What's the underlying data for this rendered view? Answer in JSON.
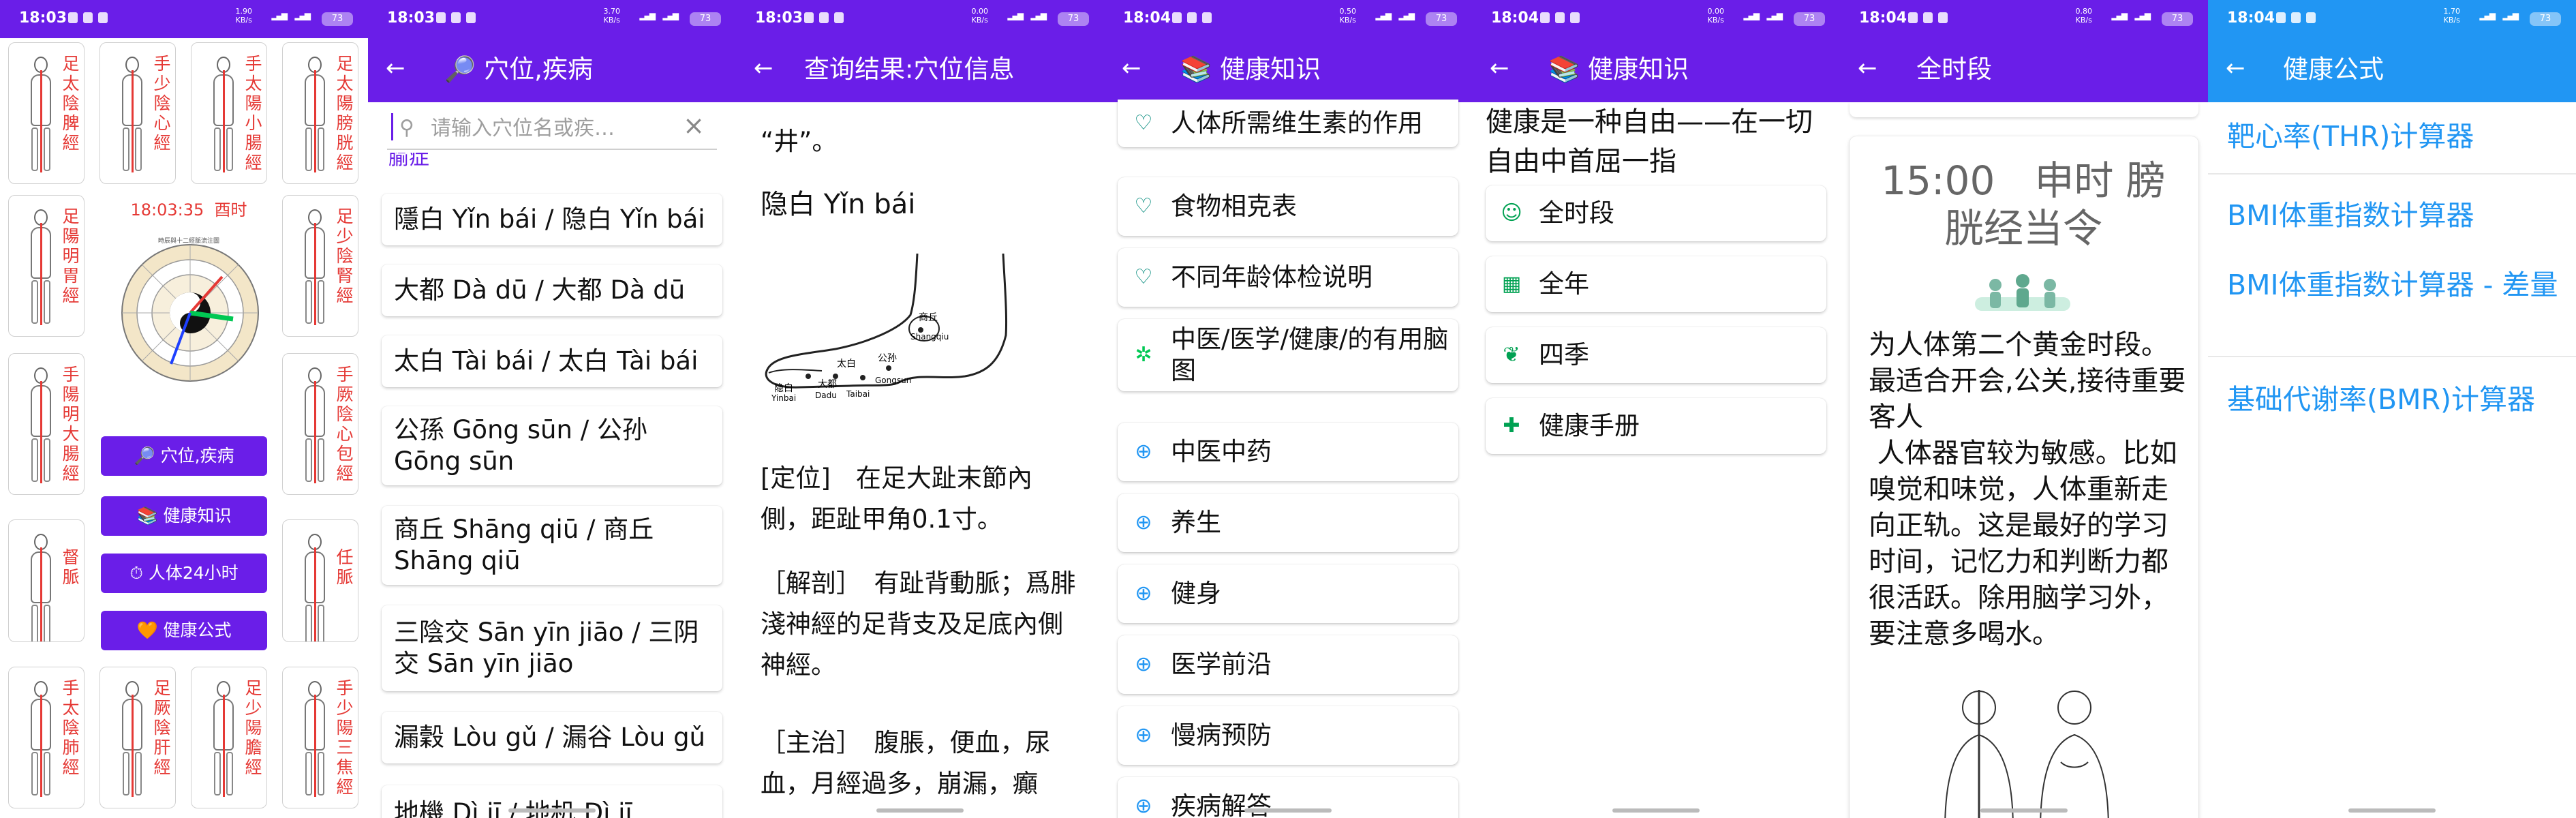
{
  "status_bar": {
    "phone1": {
      "time": "18:03",
      "net_speed": "1.90",
      "net_unit": "KB/s",
      "battery": "73"
    },
    "phone2": {
      "time": "18:03",
      "net_speed": "3.70",
      "net_unit": "KB/s",
      "battery": "73"
    },
    "phone3": {
      "time": "18:03",
      "net_speed": "0.00",
      "net_unit": "KB/s",
      "battery": "73"
    },
    "phone4": {
      "time": "18:04",
      "net_speed": "0.50",
      "net_unit": "KB/s",
      "battery": "73"
    },
    "phone5": {
      "time": "18:04",
      "net_speed": "0.00",
      "net_unit": "KB/s",
      "battery": "73"
    },
    "phone6": {
      "time": "18:04",
      "net_speed": "0.80",
      "net_unit": "KB/s",
      "battery": "73"
    },
    "phone7": {
      "time": "18:04",
      "net_speed": "1.70",
      "net_unit": "KB/s",
      "battery": "73"
    }
  },
  "colors": {
    "purple": "#6a1ee8",
    "blue": "#2196f3",
    "red": "#e53935",
    "green": "#00c853"
  },
  "phone1": {
    "meridians": [
      "足太陰脾經",
      "手少陰心經",
      "手太陽小腸經",
      "足太陽膀胱經",
      "足陽明胃經",
      "足少陰腎經",
      "手陽明大腸經",
      "手厥陰心包經",
      "督脈",
      "任脈",
      "手太陰肺經",
      "足厥陰肝經",
      "足少陽膽經",
      "手少陽三焦經"
    ],
    "clock_time": "18:03:35",
    "clock_period": "酉时",
    "dial_caption": "時辰與十二經脈流注圖",
    "buttons": [
      {
        "icon": "🔎",
        "label": "穴位,疾病"
      },
      {
        "icon": "📚",
        "label": "健康知识"
      },
      {
        "icon": "⏱",
        "label": "人体24小时"
      },
      {
        "icon": "🧡",
        "label": "健康公式"
      }
    ]
  },
  "phone2": {
    "title": "穴位,疾病",
    "title_icon": "🔎",
    "search_placeholder": "请输入穴位名或疾…",
    "cut_text": "腧症",
    "results": [
      "隱白 Yǐn bái / 隐白 Yǐn bái",
      "大都 Dà dū / 大都 Dà dū",
      "太白 Tài bái / 太白 Tài bái",
      "公孫 Gōng sūn / 公孙 Gōng sūn",
      "商丘 Shāng qiū / 商丘 Shāng qiū",
      "三陰交 Sān yīn jiāo / 三阴交 Sān yīn jiāo",
      "漏穀 Lòu gǔ / 漏谷 Lòu gǔ",
      "地機 Dì jī / 地机 Dì jī"
    ]
  },
  "phone3": {
    "title": "查询结果:穴位信息",
    "top_cut": "“井”。",
    "heading": "隐白 Yǐn bái",
    "figure_labels": [
      "商丘",
      "Shangqiu",
      "公孙",
      "Gongsun",
      "隐白",
      "Yinbai",
      "大都",
      "Dadu",
      "太白",
      "Taibai"
    ],
    "location": "[定位]　在足大趾末節內側，距趾甲角0.1寸。",
    "anatomy": "［解剖］　有趾背動脈；爲腓淺神經的足背支及足底內側神經。",
    "indication": "［主治］　腹脹，便血，尿血，月經過多，崩漏，癲"
  },
  "phone4": {
    "title": "健康知识",
    "title_icon": "📚",
    "items": [
      {
        "icon": "heartbeat-icon",
        "label": "人体所需维生素的作用"
      },
      {
        "icon": "heartbeat-icon",
        "label": "食物相克表"
      },
      {
        "icon": "heartbeat-icon",
        "label": "不同年龄体检说明"
      },
      {
        "icon": "network-icon",
        "label": "中医/医学/健康/的有用脑图"
      },
      {
        "icon": "globe-icon",
        "label": "中医中药"
      },
      {
        "icon": "globe-icon",
        "label": "养生"
      },
      {
        "icon": "globe-icon",
        "label": "健身"
      },
      {
        "icon": "globe-icon",
        "label": "医学前沿"
      },
      {
        "icon": "globe-icon",
        "label": "慢病预防"
      },
      {
        "icon": "globe-icon",
        "label": "疾病解答"
      }
    ]
  },
  "phone5": {
    "title": "健康知识",
    "title_icon": "📚",
    "intro": "健康是一种自由——在一切自由中首屈一指",
    "items": [
      {
        "icon": "person-icon",
        "label": "全时段"
      },
      {
        "icon": "calendar-icon",
        "label": "全年"
      },
      {
        "icon": "leaf-icon",
        "label": "四季"
      },
      {
        "icon": "book-plus-icon",
        "label": "健康手册"
      }
    ]
  },
  "phone6": {
    "title": "全时段",
    "card_title": "15:00　申时 膀胱经当令",
    "body": "为人体第二个黄金时段。最适合开会,公关,接待重要客人\n 人体器官较为敏感。比如嗅觉和味觉，人体重新走向正轨。这是最好的学习时间，记忆力和判断力都很活跃。除用脑学习外，要注意多喝水。"
  },
  "phone7": {
    "title": "健康公式",
    "links": [
      "靶心率(THR)计算器",
      "BMI体重指数计算器",
      "BMI体重指数计算器 - 差量",
      "基础代谢率(BMR)计算器"
    ]
  }
}
